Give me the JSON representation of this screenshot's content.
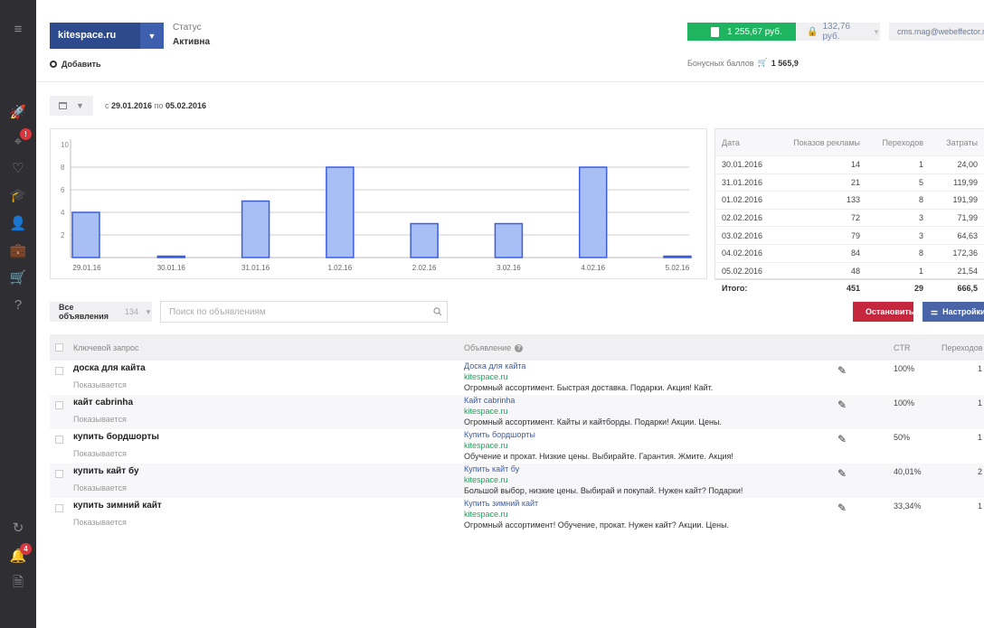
{
  "rail": {
    "items": [
      {
        "name": "menu-icon",
        "glyph": "≡"
      },
      {
        "name": "rocket-icon",
        "glyph": "🚀"
      },
      {
        "name": "target-icon",
        "glyph": "⌖",
        "badge": "!"
      },
      {
        "name": "heart-icon",
        "glyph": "♡"
      },
      {
        "name": "graduation-icon",
        "glyph": "🎓"
      },
      {
        "name": "user-icon",
        "glyph": "👤"
      },
      {
        "name": "briefcase-icon",
        "glyph": "💼"
      },
      {
        "name": "cart-icon",
        "glyph": "🛒"
      },
      {
        "name": "help-icon",
        "glyph": "?"
      },
      {
        "name": "sync-icon",
        "glyph": "↻"
      },
      {
        "name": "bell-icon",
        "glyph": "🔔",
        "badge": "4"
      },
      {
        "name": "document-icon",
        "glyph": "🗎"
      }
    ],
    "colors": {
      "background": "#2f2f33",
      "badge": "#d9363e"
    }
  },
  "header": {
    "site": "kitespace.ru",
    "status_label": "Статус",
    "status_value": "Активна",
    "add_label": "Добавить",
    "balance": "1 255,67 руб.",
    "hold": "132,76 руб.",
    "user": "cms.mag@webeffector.ru",
    "bonus_label": "Бонусных баллов",
    "bonus_value": "1 565,9"
  },
  "filter": {
    "date_prefix": "с",
    "date_from": "29.01.2016",
    "date_middle": "по",
    "date_to": "05.02.2016"
  },
  "chart_data": {
    "type": "bar",
    "categories": [
      "29.01.16",
      "30.01.16",
      "31.01.16",
      "1.02.16",
      "2.02.16",
      "3.02.16",
      "4.02.16",
      "5.02.16"
    ],
    "values": [
      4,
      0,
      5,
      8,
      3,
      3,
      8,
      0
    ],
    "yticks": [
      2,
      4,
      6,
      8,
      10
    ],
    "ylim": [
      0,
      10
    ],
    "grid": true,
    "colors": {
      "fill": "#a8bff5",
      "stroke": "#3b5de0"
    }
  },
  "stats": {
    "headers": [
      "Дата",
      "Показов рекламы",
      "Переходов",
      "Затраты"
    ],
    "rows": [
      {
        "date": "30.01.2016",
        "shows": "14",
        "clicks": "1",
        "cost": "24,00"
      },
      {
        "date": "31.01.2016",
        "shows": "21",
        "clicks": "5",
        "cost": "119,99"
      },
      {
        "date": "01.02.2016",
        "shows": "133",
        "clicks": "8",
        "cost": "191,99"
      },
      {
        "date": "02.02.2016",
        "shows": "72",
        "clicks": "3",
        "cost": "71,99"
      },
      {
        "date": "03.02.2016",
        "shows": "79",
        "clicks": "3",
        "cost": "64,63"
      },
      {
        "date": "04.02.2016",
        "shows": "84",
        "clicks": "8",
        "cost": "172,36"
      },
      {
        "date": "05.02.2016",
        "shows": "48",
        "clicks": "1",
        "cost": "21,54"
      }
    ],
    "total": {
      "label": "Итого:",
      "shows": "451",
      "clicks": "29",
      "cost": "666,5"
    }
  },
  "ads_toolbar": {
    "all_label": "Все объявления",
    "all_count": "134",
    "search_placeholder": "Поиск по объявлениям",
    "stop_label": "Остановить",
    "settings_label": "Настройки"
  },
  "ads": {
    "headers": {
      "keyword": "Ключевой запрос",
      "ad": "Объявление",
      "ctr": "CTR",
      "clicks": "Переходов"
    },
    "rows": [
      {
        "keyword": "доска для кайта",
        "status": "Показывается",
        "title": "Доска для кайта",
        "url": "kitespace.ru",
        "text": "Огромный ассортимент. Быстрая доставка. Подарки. Акция! Кайт.",
        "ctr": "100%",
        "clicks": "1"
      },
      {
        "keyword": "кайт cabrinha",
        "status": "Показывается",
        "title": "Кайт cabrinha",
        "url": "kitespace.ru",
        "text": "Огромный ассортимент. Кайты и кайтборды. Подарки! Акции. Цены.",
        "ctr": "100%",
        "clicks": "1"
      },
      {
        "keyword": "купить бордшорты",
        "status": "Показывается",
        "title": "Купить бордшорты",
        "url": "kitespace.ru",
        "text": "Обучение и прокат. Низкие цены. Выбирайте. Гарантия. Жмите. Акция!",
        "ctr": "50%",
        "clicks": "1"
      },
      {
        "keyword": "купить кайт бу",
        "status": "Показывается",
        "title": "Купить кайт бу",
        "url": "kitespace.ru",
        "text": "Большой выбор, низкие цены. Выбирай и покупай. Нужен кайт? Подарки!",
        "ctr": "40,01%",
        "clicks": "2"
      },
      {
        "keyword": "купить зимний кайт",
        "status": "Показывается",
        "title": "Купить зимний кайт",
        "url": "kitespace.ru",
        "text": "Огромный ассортимент! Обучение, прокат. Нужен кайт? Акции. Цены.",
        "ctr": "33,34%",
        "clicks": "1"
      }
    ]
  }
}
